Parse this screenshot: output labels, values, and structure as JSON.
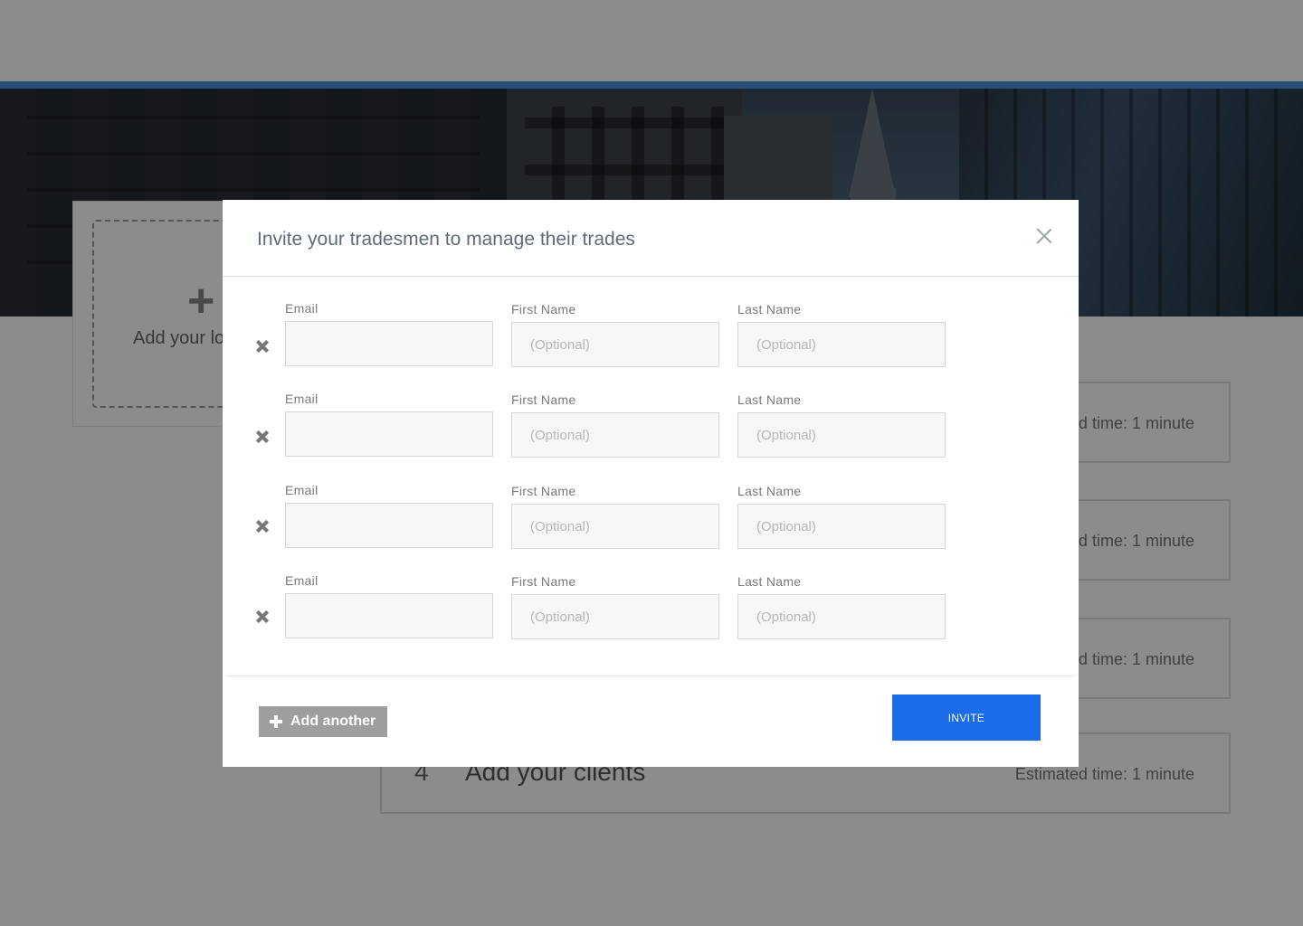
{
  "background": {
    "upload_card": {
      "plus": "+",
      "label": "Add your lo"
    },
    "steps": [
      {
        "num": "",
        "title": "",
        "eta": "ed time: 1 minute"
      },
      {
        "num": "",
        "title": "",
        "eta": "ed time: 1 minute"
      },
      {
        "num": "",
        "title": "",
        "eta": "ed time: 1 minute"
      },
      {
        "num": "4",
        "title": "Add your clients",
        "eta": "Estimated time: 1 minute"
      }
    ]
  },
  "modal": {
    "title": "Invite your tradesmen to manage their trades",
    "close_icon": "close-icon",
    "rows": [
      {
        "email_label": "Email",
        "email_value": "",
        "first_label": "First Name",
        "first_placeholder": "(Optional)",
        "last_label": "Last Name",
        "last_placeholder": "(Optional)"
      },
      {
        "email_label": "Email",
        "email_value": "",
        "first_label": "First Name",
        "first_placeholder": "(Optional)",
        "last_label": "Last Name",
        "last_placeholder": "(Optional)"
      },
      {
        "email_label": "Email",
        "email_value": "",
        "first_label": "First Name",
        "first_placeholder": "(Optional)",
        "last_label": "Last Name",
        "last_placeholder": "(Optional)"
      },
      {
        "email_label": "Email",
        "email_value": "",
        "first_label": "First Name",
        "first_placeholder": "(Optional)",
        "last_label": "Last Name",
        "last_placeholder": "(Optional)"
      }
    ],
    "add_another_label": "Add another",
    "invite_label": "INVITE"
  },
  "colors": {
    "accent_line": "#4a90e2",
    "invite_button": "#1b6ce8",
    "add_another_button": "#9e9e9e",
    "overlay": "rgba(0,0,0,0.45)"
  }
}
